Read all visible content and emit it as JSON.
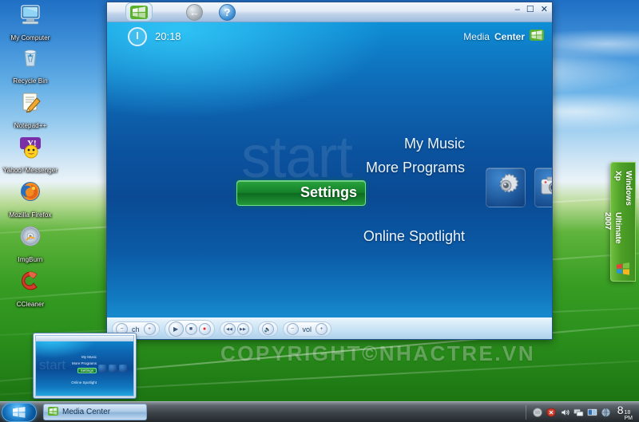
{
  "desktop": {
    "icons": [
      {
        "label": "My Computer",
        "icon": "my-computer-icon"
      },
      {
        "label": "Recycle Bin",
        "icon": "recycle-bin-icon"
      },
      {
        "label": "Notepad++",
        "icon": "notepad-plus-plus-icon"
      },
      {
        "label": "Yahoo! Messenger",
        "icon": "yahoo-messenger-icon"
      },
      {
        "label": "Mozilla Firefox",
        "icon": "firefox-icon"
      },
      {
        "label": "ImgBurn",
        "icon": "imgburn-icon"
      },
      {
        "label": "CCleaner",
        "icon": "ccleaner-icon"
      }
    ],
    "watermark": "COPYRIGHT©NHACTRE.VN"
  },
  "sidebar_gadget": {
    "line1": "Windows Xp",
    "line2": "Ultimate 2007",
    "logo": "windows-flag-icon"
  },
  "window": {
    "title": "Media Center",
    "controls": {
      "minimize": "–",
      "maximize": "☐",
      "close": "✕"
    },
    "nav": {
      "start_orb": "windows-start-orb-icon",
      "back": "←",
      "help": "?"
    }
  },
  "media_center": {
    "clock": "20:18",
    "power_button": "power-icon",
    "brand_light": "Media",
    "brand_bold": "Center",
    "brand_logo": "media-center-logo-icon",
    "watermark_text": "start",
    "menu": [
      {
        "label": "My Music",
        "selected": false
      },
      {
        "label": "More Programs",
        "selected": false
      },
      {
        "label": "Settings",
        "selected": true
      },
      {
        "label": "Online Spotlight",
        "selected": false
      }
    ],
    "tiles": [
      {
        "name": "settings-tile",
        "icon": "gear-icon"
      },
      {
        "name": "pictures-tile",
        "icon": "camera-icon"
      },
      {
        "name": "help-tile",
        "icon": "question-mark-icon"
      }
    ],
    "transport": {
      "ch_label": "ch",
      "vol_label": "vol",
      "minus": "−",
      "plus": "+",
      "play": "▶",
      "stop": "■",
      "record": "●",
      "rewind": "◀◀",
      "forward": "▶▶",
      "mute": "🔈"
    }
  },
  "thumbnail_preview": {
    "items": [
      "My Music",
      "More Programs",
      "Settings",
      "Online Spotlight"
    ],
    "watermark": "start"
  },
  "taskbar": {
    "start_label": "windows-start-orb-icon",
    "buttons": [
      {
        "label": "Media Center",
        "icon": "media-center-icon",
        "active": true
      }
    ],
    "tray_icons": [
      "gray-circle-icon",
      "security-shield-icon",
      "volume-icon",
      "network-icon",
      "display-icon",
      "app-icon"
    ],
    "clock_hour": "8",
    "clock_minute": "18",
    "clock_period": "PM"
  },
  "colors": {
    "mce_accent_green": "#15802a",
    "mce_blue": "#0a4a94",
    "gadget_green": "#4ea028",
    "desktop_sky": "#3e8fd8",
    "desktop_grass": "#369c22"
  }
}
